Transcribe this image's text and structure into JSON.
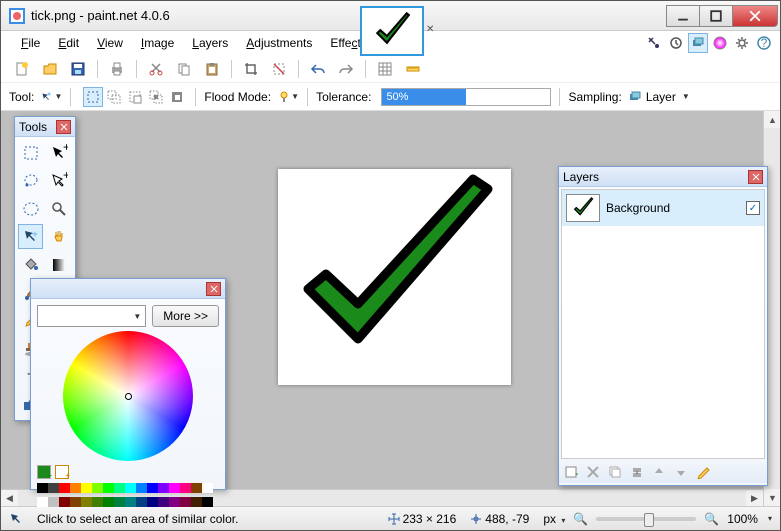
{
  "title": "tick.png - paint.net 4.0.6",
  "menu": {
    "file": "File",
    "edit": "Edit",
    "view": "View",
    "image": "Image",
    "layers": "Layers",
    "adjustments": "Adjustments",
    "effects": "Effects"
  },
  "toolbar2": {
    "tool_label": "Tool:",
    "flood_label": "Flood Mode:",
    "tolerance_label": "Tolerance:",
    "tolerance_value": "50%",
    "sampling_label": "Sampling:",
    "sampling_value": "Layer"
  },
  "status": {
    "hint": "Click to select an area of similar color.",
    "dims": "233 × 216",
    "cursor": "488, -79",
    "unit": "px",
    "zoom": "100%"
  },
  "panels": {
    "tools_title": "Tools",
    "colors_title": "",
    "more_btn": "More >>",
    "layers_title": "Layers",
    "layer_name": "Background"
  },
  "palette": [
    "#000",
    "#404040",
    "#f00",
    "#ff8000",
    "#ff0",
    "#80ff00",
    "#0f0",
    "#00ff80",
    "#0ff",
    "#0080ff",
    "#00f",
    "#8000ff",
    "#f0f",
    "#ff0080",
    "#804000",
    "#fff"
  ],
  "palette2": [
    "#fff",
    "#c0c0c0",
    "#800000",
    "#804000",
    "#808000",
    "#408000",
    "#008000",
    "#008040",
    "#008080",
    "#004080",
    "#000080",
    "#400080",
    "#800080",
    "#800040",
    "#402000",
    "#000"
  ]
}
